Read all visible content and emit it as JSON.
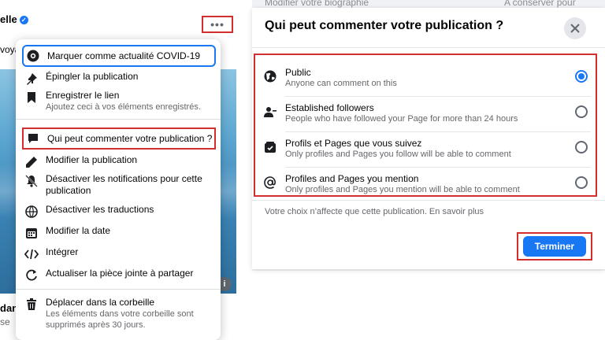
{
  "left": {
    "post_name": "elle",
    "post_snippet": "voya",
    "bottom_snippet_1": "dan",
    "bottom_snippet_2": "se",
    "more_label": "•••",
    "info_label": "i",
    "menu": [
      {
        "label": "Marquer comme actualité COVID-19",
        "icon": "covid-badge-icon"
      },
      {
        "label": "Épingler la publication",
        "icon": "pin-icon"
      },
      {
        "label": "Enregistrer le lien",
        "sub": "Ajoutez ceci à vos éléments enregistrés.",
        "icon": "bookmark-icon"
      },
      {
        "label": "Qui peut commenter votre publication ?",
        "icon": "comment-icon"
      },
      {
        "label": "Modifier la publication",
        "icon": "pencil-icon"
      },
      {
        "label": "Désactiver les notifications pour cette",
        "label2": "publication",
        "icon": "bell-off-icon"
      },
      {
        "label": "Désactiver les traductions",
        "icon": "translate-icon"
      },
      {
        "label": "Modifier la date",
        "icon": "calendar-icon"
      },
      {
        "label": "Intégrer",
        "icon": "code-icon"
      },
      {
        "label": "Actualiser la pièce jointe à partager",
        "icon": "refresh-icon"
      },
      {
        "label": "Déplacer dans la corbeille",
        "sub": "Les éléments dans votre corbeille sont",
        "sub2": "supprimés après 30 jours.",
        "icon": "trash-icon"
      }
    ]
  },
  "right": {
    "bio_text": "Modifier votre biographie",
    "keep_text": "A conserver pour",
    "dialog": {
      "title": "Qui peut commenter votre publication ?",
      "close_icon": "close-icon",
      "options": [
        {
          "title": "Public",
          "desc": "Anyone can comment on this",
          "icon": "globe-icon",
          "selected": true
        },
        {
          "title": "Established followers",
          "desc": "People who have followed your Page for more than 24 hours",
          "icon": "followers-icon",
          "selected": false
        },
        {
          "title": "Profils et Pages que vous suivez",
          "desc": "Only profiles and Pages you follow will be able to comment",
          "icon": "following-icon",
          "selected": false
        },
        {
          "title": "Profiles and Pages you mention",
          "desc": "Only profiles and Pages you mention will be able to comment",
          "icon": "at-icon",
          "selected": false
        }
      ],
      "footnote": "Votre choix n’affecte que cette publication. En savoir plus",
      "done_label": "Terminer"
    }
  },
  "colors": {
    "accent": "#1877f2",
    "highlight_red": "#d32f2f",
    "text_primary": "#050505",
    "text_secondary": "#65676b"
  }
}
